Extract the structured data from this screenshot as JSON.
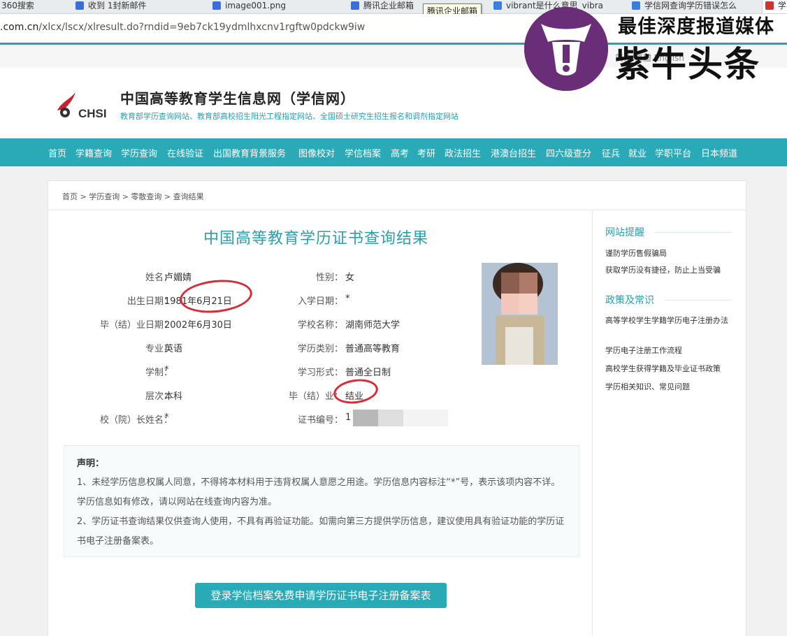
{
  "browser": {
    "tabs": [
      {
        "label": "360搜索",
        "color": "#2d8cf0"
      },
      {
        "label": "收到 1封新邮件",
        "color": "#3a6fd8"
      },
      {
        "label": "image001.png",
        "color": "#3a6fd8"
      },
      {
        "label": "腾讯企业邮箱",
        "color": "#3a6fd8"
      },
      {
        "label": "vibrant是什么意思_vibra",
        "color": "#3b7ddd"
      },
      {
        "label": "学信网查询学历错误怎么",
        "color": "#3b7ddd"
      },
      {
        "label": "学",
        "color": "#c33"
      }
    ],
    "tooltip": "腾讯企业邮箱",
    "url_domain": ".com.cn",
    "url_path": "/xlcx/lscx/xlresult.do?rndid=9eb7ck19ydmlhxcnv1rgftw0pdckw9iw"
  },
  "header": {
    "lang_links": "简体  繁體  English",
    "logo_text": "CHSI",
    "title": "中国高等教育学生信息网（学信网）",
    "subtitle": "教育部学历查询网站、教育部高校招生阳光工程指定网站、全国硕士研究生招生报名和调剂指定网站"
  },
  "nav": [
    "首页",
    "学籍查询",
    "学历查询",
    "在线验证",
    "出国教育背景服务",
    "图像校对",
    "学信档案",
    "高考",
    "考研",
    "政法招生",
    "港澳台招生",
    "四六级查分",
    "征兵",
    "就业",
    "学职平台",
    "日本频道"
  ],
  "breadcrumb": "首页 > 学历查询 > 零散查询 > 查询结果",
  "result": {
    "title": "中国高等教育学历证书查询结果",
    "fields": [
      {
        "label": "姓名：",
        "value": "卢媚婧"
      },
      {
        "label": "性别：",
        "value": "女"
      },
      {
        "label": "出生日期：",
        "value": "1981年6月21日"
      },
      {
        "label": "入学日期：",
        "value": "*"
      },
      {
        "label": "毕（结）业日期：",
        "value": "2002年6月30日"
      },
      {
        "label": "学校名称：",
        "value": "湖南师范大学"
      },
      {
        "label": "专业：",
        "value": "英语"
      },
      {
        "label": "学历类别：",
        "value": "普通高等教育"
      },
      {
        "label": "学制：",
        "value": "*"
      },
      {
        "label": "学习形式：",
        "value": "普通全日制"
      },
      {
        "label": "层次：",
        "value": "本科"
      },
      {
        "label": "毕（结）业：",
        "value": "结业"
      },
      {
        "label": "校（院）长姓名：",
        "value": "*"
      },
      {
        "label": "证书编号：",
        "value": "1"
      }
    ]
  },
  "notice": {
    "title": "声明：",
    "p1": "1、未经学历信息权属人同意，不得将本材料用于违背权属人意愿之用途。学历信息内容标注“*”号，表示该项内容不详。学历信息如有修改，请以网站在线查询内容为准。",
    "p2": "2、学历证书查询结果仅供查询人使用，不具有再验证功能。如需向第三方提供学历信息，建议使用具有验证功能的学历证书电子注册备案表。"
  },
  "apply_button": "登录学信档案免费申请学历证书电子注册备案表",
  "sidebar": {
    "section1": "网站提醒",
    "links1": [
      "谨防学历售假骗局",
      "获取学历没有捷径，防止上当受骗"
    ],
    "section2": "政策及常识",
    "links2": [
      "高等学校学生学籍学历电子注册办法",
      "学历电子注册工作流程",
      "高校学生获得学籍及毕业证书政策",
      "学历相关知识、常见问题"
    ]
  },
  "watermark": {
    "line1": "最佳深度报道媒体",
    "line2": "紫牛头条",
    "color": "#6a2d78"
  },
  "colors": {
    "accent": "#2aa9b7",
    "highlight": "#d92b36"
  }
}
